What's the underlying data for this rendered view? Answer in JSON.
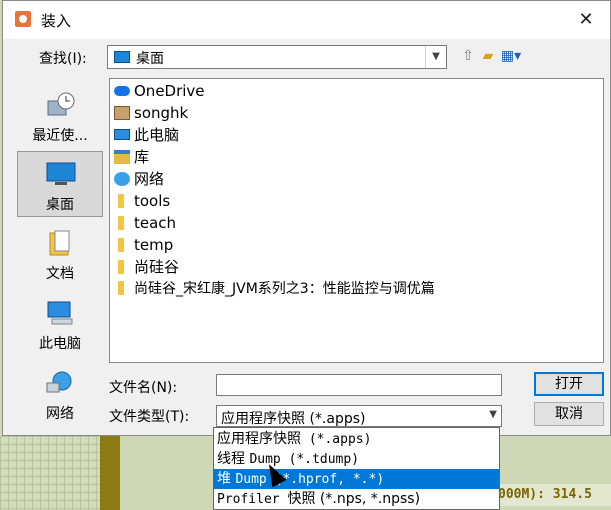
{
  "dialog": {
    "title": "装入",
    "close_glyph": "✕"
  },
  "look_in": {
    "label": "查找(I):",
    "value": "桌面"
  },
  "toolbar": {
    "up_icon": "up-folder-icon",
    "new_folder_icon": "new-folder-icon",
    "view_icon": "view-menu-icon"
  },
  "places": [
    {
      "label": "最近使...",
      "icon": "recent-icon"
    },
    {
      "label": "桌面",
      "icon": "desktop-icon",
      "selected": true
    },
    {
      "label": "文档",
      "icon": "documents-icon"
    },
    {
      "label": "此电脑",
      "icon": "this-pc-icon"
    },
    {
      "label": "网络",
      "icon": "network-icon"
    }
  ],
  "files": [
    {
      "name": "OneDrive",
      "icon": "onedrive-icon"
    },
    {
      "name": "songhk",
      "icon": "user-folder-icon"
    },
    {
      "name": "此电脑",
      "icon": "this-pc-icon"
    },
    {
      "name": "库",
      "icon": "library-icon"
    },
    {
      "name": "网络",
      "icon": "network-icon"
    },
    {
      "name": "tools",
      "icon": "folder-icon"
    },
    {
      "name": "teach",
      "icon": "folder-icon"
    },
    {
      "name": "temp",
      "icon": "folder-icon"
    },
    {
      "name": "尚硅谷",
      "icon": "folder-icon"
    },
    {
      "name": "尚硅谷_宋红康_JVM系列之3：性能监控与调优篇",
      "icon": "folder-icon"
    }
  ],
  "file_name": {
    "label": "文件名(N):",
    "value": ""
  },
  "file_type": {
    "label": "文件类型(T):",
    "value": "应用程序快照 (*.apps)",
    "options": [
      {
        "a": "应用程序快照",
        "b": " (*.apps)"
      },
      {
        "a": "线程 ",
        "b": "Dump (*.tdump)"
      },
      {
        "a": "堆 ",
        "b": "Dump (*.hprof, *.*)"
      },
      {
        "a": "Profiler ",
        "b": "快照 (*.nps, *.npss)"
      }
    ],
    "selected_index": 2
  },
  "buttons": {
    "open": "打开",
    "cancel": "取消"
  },
  "background": {
    "status_text": "000M): 314.5"
  },
  "colors": {
    "selection": "#0078d7",
    "default_button_border": "#0078d7"
  }
}
